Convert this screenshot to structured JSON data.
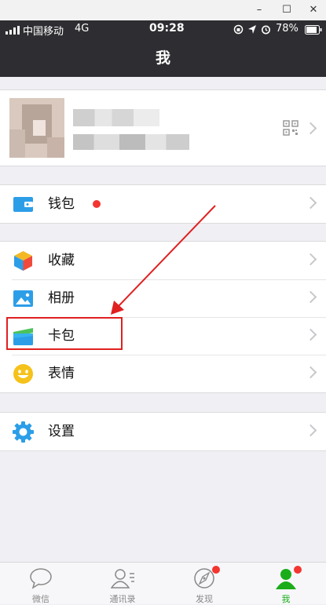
{
  "window": {
    "minimize": "–",
    "maximize": "☐",
    "close": "✕"
  },
  "status": {
    "carrier": "中国移动",
    "network": "4G",
    "time": "09:28",
    "battery": "78%"
  },
  "nav": {
    "title": "我"
  },
  "menu": {
    "wallet": "钱包",
    "favorites": "收藏",
    "album": "相册",
    "cards": "卡包",
    "stickers": "表情",
    "settings": "设置"
  },
  "tabs": [
    {
      "label": "微信",
      "icon": "chat-bubble-icon"
    },
    {
      "label": "通讯录",
      "icon": "contacts-icon"
    },
    {
      "label": "发现",
      "icon": "compass-icon"
    },
    {
      "label": "我",
      "icon": "person-icon"
    }
  ],
  "colors": {
    "accent": "#1aad19",
    "badge": "#f43530",
    "annotation": "#e02020",
    "header": "#2e2e32"
  }
}
